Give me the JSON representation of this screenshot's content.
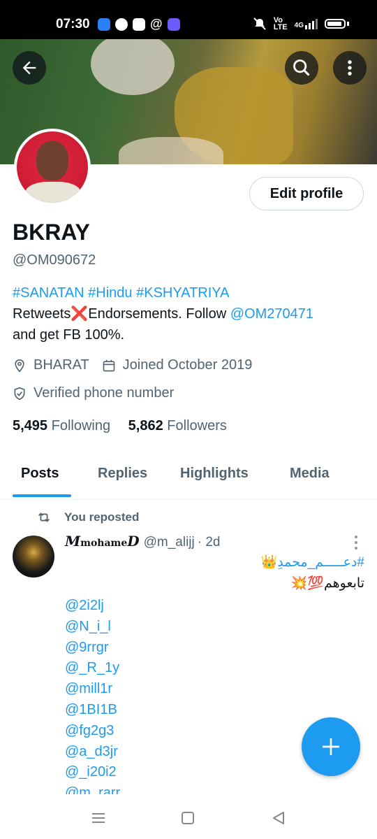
{
  "status_bar": {
    "time": "07:30",
    "network": "4G",
    "icons": [
      "square-app-icon",
      "phone-icon",
      "slack-icon",
      "at-icon",
      "game-icon",
      "mute-icon",
      "volte-icon",
      "signal-icon",
      "battery-icon"
    ]
  },
  "profile": {
    "name": "BKRAY",
    "handle": "@OM090672",
    "edit_button": "Edit profile",
    "bio": {
      "hashtags": "#SANATAN #Hindu #KSHYATRIYA",
      "line_prefix": "Retweets",
      "cross": "❌",
      "line_mid": "Endorsements. Follow ",
      "mention": "@OM270471",
      "line_suffix": "and get FB 100%."
    },
    "location": "BHARAT",
    "joined": "Joined October 2019",
    "verified": "Verified phone number",
    "following_count": "5,495",
    "following_label": "Following",
    "followers_count": "5,862",
    "followers_label": "Followers"
  },
  "tabs": [
    "Posts",
    "Replies",
    "Highlights",
    "Media"
  ],
  "active_tab": "Posts",
  "post": {
    "repost_label": "You reposted",
    "author_name_main": "M",
    "author_name_sub": "mohame",
    "author_name_end": "D",
    "author_handle": "@m_alijj",
    "time": "· 2d",
    "hashtag_line": "#دعـــــم_محمدِ👑",
    "follow_line": "تابعوهم💯💥",
    "mentions": [
      "@2i2lj",
      "@N_i_l",
      "@9rrgr",
      "@_R_1y",
      "@mill1r",
      "@1BI1B",
      "@fg2g3",
      "@a_d3jr",
      "@_i20i2",
      "@m_rarr"
    ]
  },
  "colors": {
    "accent": "#1d9bf0",
    "text_primary": "#0f1419",
    "text_secondary": "#536471"
  }
}
